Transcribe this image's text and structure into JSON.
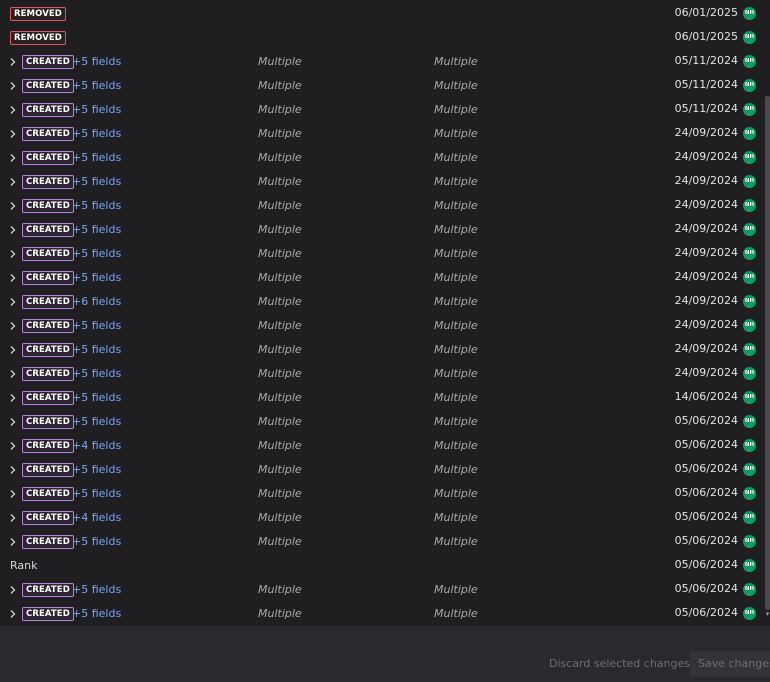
{
  "rows": [
    {
      "type": "removed",
      "badge": "REMOVED",
      "date": "06/01/2025",
      "avatar": "NH"
    },
    {
      "type": "removed",
      "badge": "REMOVED",
      "date": "06/01/2025",
      "avatar": "NH"
    },
    {
      "type": "created",
      "badge": "CREATED",
      "fields": "+5 fields",
      "col1": "Multiple",
      "col2": "Multiple",
      "date": "05/11/2024",
      "avatar": "NH"
    },
    {
      "type": "created",
      "badge": "CREATED",
      "fields": "+5 fields",
      "col1": "Multiple",
      "col2": "Multiple",
      "date": "05/11/2024",
      "avatar": "NH"
    },
    {
      "type": "created",
      "badge": "CREATED",
      "fields": "+5 fields",
      "col1": "Multiple",
      "col2": "Multiple",
      "date": "05/11/2024",
      "avatar": "NH"
    },
    {
      "type": "created",
      "badge": "CREATED",
      "fields": "+5 fields",
      "col1": "Multiple",
      "col2": "Multiple",
      "date": "24/09/2024",
      "avatar": "NH"
    },
    {
      "type": "created",
      "badge": "CREATED",
      "fields": "+5 fields",
      "col1": "Multiple",
      "col2": "Multiple",
      "date": "24/09/2024",
      "avatar": "NH"
    },
    {
      "type": "created",
      "badge": "CREATED",
      "fields": "+5 fields",
      "col1": "Multiple",
      "col2": "Multiple",
      "date": "24/09/2024",
      "avatar": "NH"
    },
    {
      "type": "created",
      "badge": "CREATED",
      "fields": "+5 fields",
      "col1": "Multiple",
      "col2": "Multiple",
      "date": "24/09/2024",
      "avatar": "NH"
    },
    {
      "type": "created",
      "badge": "CREATED",
      "fields": "+5 fields",
      "col1": "Multiple",
      "col2": "Multiple",
      "date": "24/09/2024",
      "avatar": "NH"
    },
    {
      "type": "created",
      "badge": "CREATED",
      "fields": "+5 fields",
      "col1": "Multiple",
      "col2": "Multiple",
      "date": "24/09/2024",
      "avatar": "NH"
    },
    {
      "type": "created",
      "badge": "CREATED",
      "fields": "+5 fields",
      "col1": "Multiple",
      "col2": "Multiple",
      "date": "24/09/2024",
      "avatar": "NH"
    },
    {
      "type": "created",
      "badge": "CREATED",
      "fields": "+6 fields",
      "col1": "Multiple",
      "col2": "Multiple",
      "date": "24/09/2024",
      "avatar": "NH"
    },
    {
      "type": "created",
      "badge": "CREATED",
      "fields": "+5 fields",
      "col1": "Multiple",
      "col2": "Multiple",
      "date": "24/09/2024",
      "avatar": "NH"
    },
    {
      "type": "created",
      "badge": "CREATED",
      "fields": "+5 fields",
      "col1": "Multiple",
      "col2": "Multiple",
      "date": "24/09/2024",
      "avatar": "NH"
    },
    {
      "type": "created",
      "badge": "CREATED",
      "fields": "+5 fields",
      "col1": "Multiple",
      "col2": "Multiple",
      "date": "24/09/2024",
      "avatar": "NH"
    },
    {
      "type": "created",
      "badge": "CREATED",
      "fields": "+5 fields",
      "col1": "Multiple",
      "col2": "Multiple",
      "date": "14/06/2024",
      "avatar": "NH"
    },
    {
      "type": "created",
      "badge": "CREATED",
      "fields": "+5 fields",
      "col1": "Multiple",
      "col2": "Multiple",
      "date": "05/06/2024",
      "avatar": "NH"
    },
    {
      "type": "created",
      "badge": "CREATED",
      "fields": "+4 fields",
      "col1": "Multiple",
      "col2": "Multiple",
      "date": "05/06/2024",
      "avatar": "NH"
    },
    {
      "type": "created",
      "badge": "CREATED",
      "fields": "+5 fields",
      "col1": "Multiple",
      "col2": "Multiple",
      "date": "05/06/2024",
      "avatar": "NH"
    },
    {
      "type": "created",
      "badge": "CREATED",
      "fields": "+5 fields",
      "col1": "Multiple",
      "col2": "Multiple",
      "date": "05/06/2024",
      "avatar": "NH"
    },
    {
      "type": "created",
      "badge": "CREATED",
      "fields": "+4 fields",
      "col1": "Multiple",
      "col2": "Multiple",
      "date": "05/06/2024",
      "avatar": "NH"
    },
    {
      "type": "created",
      "badge": "CREATED",
      "fields": "+5 fields",
      "col1": "Multiple",
      "col2": "Multiple",
      "date": "05/06/2024",
      "avatar": "NH"
    },
    {
      "type": "plain",
      "label": "Rank",
      "date": "05/06/2024",
      "avatar": "NH"
    },
    {
      "type": "created",
      "badge": "CREATED",
      "fields": "+5 fields",
      "col1": "Multiple",
      "col2": "Multiple",
      "date": "05/06/2024",
      "avatar": "NH"
    },
    {
      "type": "created",
      "badge": "CREATED",
      "fields": "+5 fields",
      "col1": "Multiple",
      "col2": "Multiple",
      "date": "05/06/2024",
      "avatar": "NH"
    }
  ],
  "footer": {
    "discard_label": "Discard selected changes",
    "save_label": "Save changes"
  },
  "icons": {
    "row_expand": "chevron-right-icon",
    "user": "avatar-icon"
  },
  "colors": {
    "created_border": "#b77fdc",
    "removed_border": "#e05555",
    "fields_link": "#7aa6f2",
    "avatar_bg": "#0f9d63"
  }
}
